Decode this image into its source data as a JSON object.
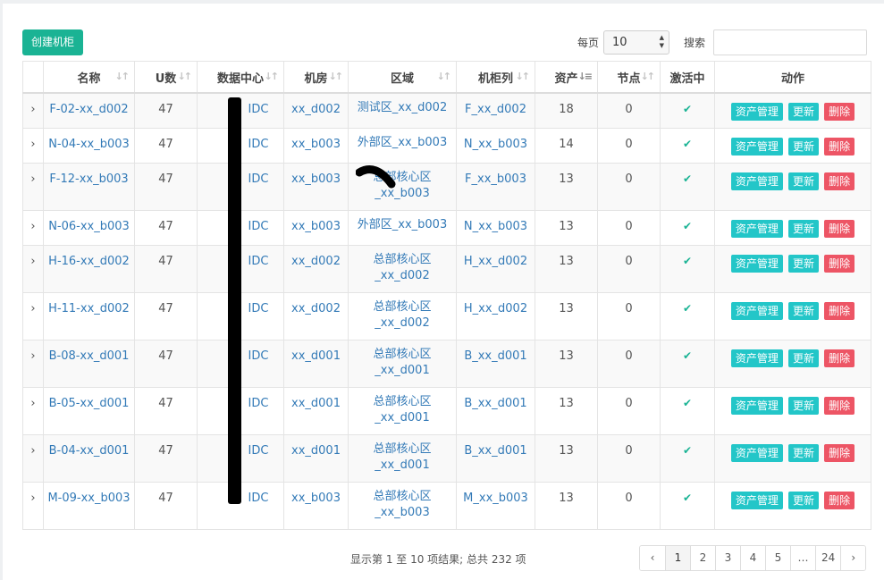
{
  "toolbar": {
    "create_label": "创建机柜",
    "per_page_label": "每页",
    "per_page_value": "10",
    "search_label": "搜索",
    "search_value": ""
  },
  "table": {
    "headers": [
      "",
      "名称",
      "U数",
      "数据中心",
      "机房",
      "区域",
      "机柜列",
      "资产",
      "节点",
      "激活中",
      "动作"
    ],
    "rows": [
      {
        "expander": "›",
        "name": "F-02-xx_d002",
        "u": "47",
        "dc": "IDC",
        "room": "xx_d002",
        "region": "测试区_xx_d002",
        "column": "F_xx_d002",
        "assets": "18",
        "nodes": "0",
        "active": "✔"
      },
      {
        "expander": "›",
        "name": "N-04-xx_b003",
        "u": "47",
        "dc": "IDC",
        "room": "xx_b003",
        "region": "外部区_xx_b003",
        "column": "N_xx_b003",
        "assets": "14",
        "nodes": "0",
        "active": "✔"
      },
      {
        "expander": "›",
        "name": "F-12-xx_b003",
        "u": "47",
        "dc": "IDC",
        "room": "xx_b003",
        "region": "总部核心区_xx_b003",
        "column": "F_xx_b003",
        "assets": "13",
        "nodes": "0",
        "active": "✔"
      },
      {
        "expander": "›",
        "name": "N-06-xx_b003",
        "u": "47",
        "dc": "IDC",
        "room": "xx_b003",
        "region": "外部区_xx_b003",
        "column": "N_xx_b003",
        "assets": "13",
        "nodes": "0",
        "active": "✔"
      },
      {
        "expander": "›",
        "name": "H-16-xx_d002",
        "u": "47",
        "dc": "IDC",
        "room": "xx_d002",
        "region": "总部核心区_xx_d002",
        "column": "H_xx_d002",
        "assets": "13",
        "nodes": "0",
        "active": "✔"
      },
      {
        "expander": "›",
        "name": "H-11-xx_d002",
        "u": "47",
        "dc": "IDC",
        "room": "xx_d002",
        "region": "总部核心区_xx_d002",
        "column": "H_xx_d002",
        "assets": "13",
        "nodes": "0",
        "active": "✔"
      },
      {
        "expander": "›",
        "name": "B-08-xx_d001",
        "u": "47",
        "dc": "IDC",
        "room": "xx_d001",
        "region": "总部核心区_xx_d001",
        "column": "B_xx_d001",
        "assets": "13",
        "nodes": "0",
        "active": "✔"
      },
      {
        "expander": "›",
        "name": "B-05-xx_d001",
        "u": "47",
        "dc": "IDC",
        "room": "xx_d001",
        "region": "总部核心区_xx_d001",
        "column": "B_xx_d001",
        "assets": "13",
        "nodes": "0",
        "active": "✔"
      },
      {
        "expander": "›",
        "name": "B-04-xx_d001",
        "u": "47",
        "dc": "IDC",
        "room": "xx_d001",
        "region": "总部核心区_xx_d001",
        "column": "B_xx_d001",
        "assets": "13",
        "nodes": "0",
        "active": "✔"
      },
      {
        "expander": "›",
        "name": "M-09-xx_b003",
        "u": "47",
        "dc": "IDC",
        "room": "xx_b003",
        "region": "总部核心区_xx_b003",
        "column": "M_xx_b003",
        "assets": "13",
        "nodes": "0",
        "active": "✔"
      }
    ],
    "actions": {
      "asset_mgmt": "资产管理",
      "update": "更新",
      "delete": "删除"
    }
  },
  "footer": {
    "summary": "显示第 1 至 10 项结果; 总共 232 项",
    "pages": [
      "‹",
      "1",
      "2",
      "3",
      "4",
      "5",
      "…",
      "24",
      "›"
    ],
    "active_page": "1"
  },
  "colors": {
    "primary": "#1ab394",
    "cyan": "#23c6c8",
    "danger": "#ed5565",
    "link": "#337ab7"
  }
}
